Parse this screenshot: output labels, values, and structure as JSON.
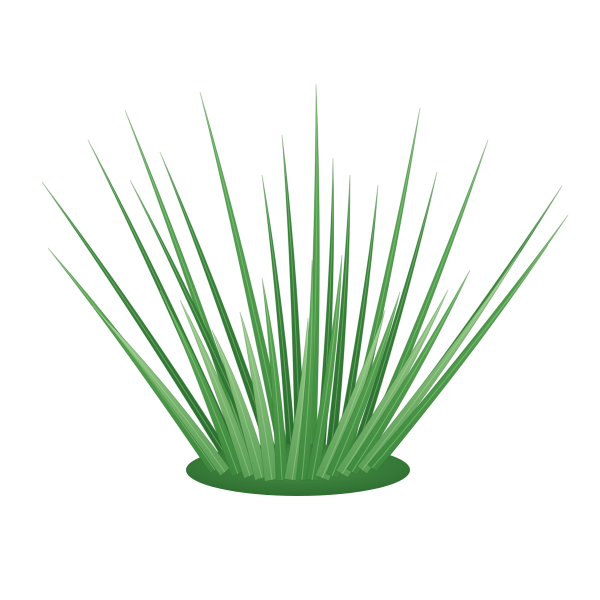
{
  "image": {
    "subject": "artificial-grass-tuft",
    "background_color": "#ffffff"
  },
  "palette": {
    "blade_dark": "#2f7a34",
    "blade_mid": "#4c9a4a",
    "blade_light": "#7cbf6d",
    "blade_pale": "#a9d49a",
    "base": "#3f8a3e"
  }
}
